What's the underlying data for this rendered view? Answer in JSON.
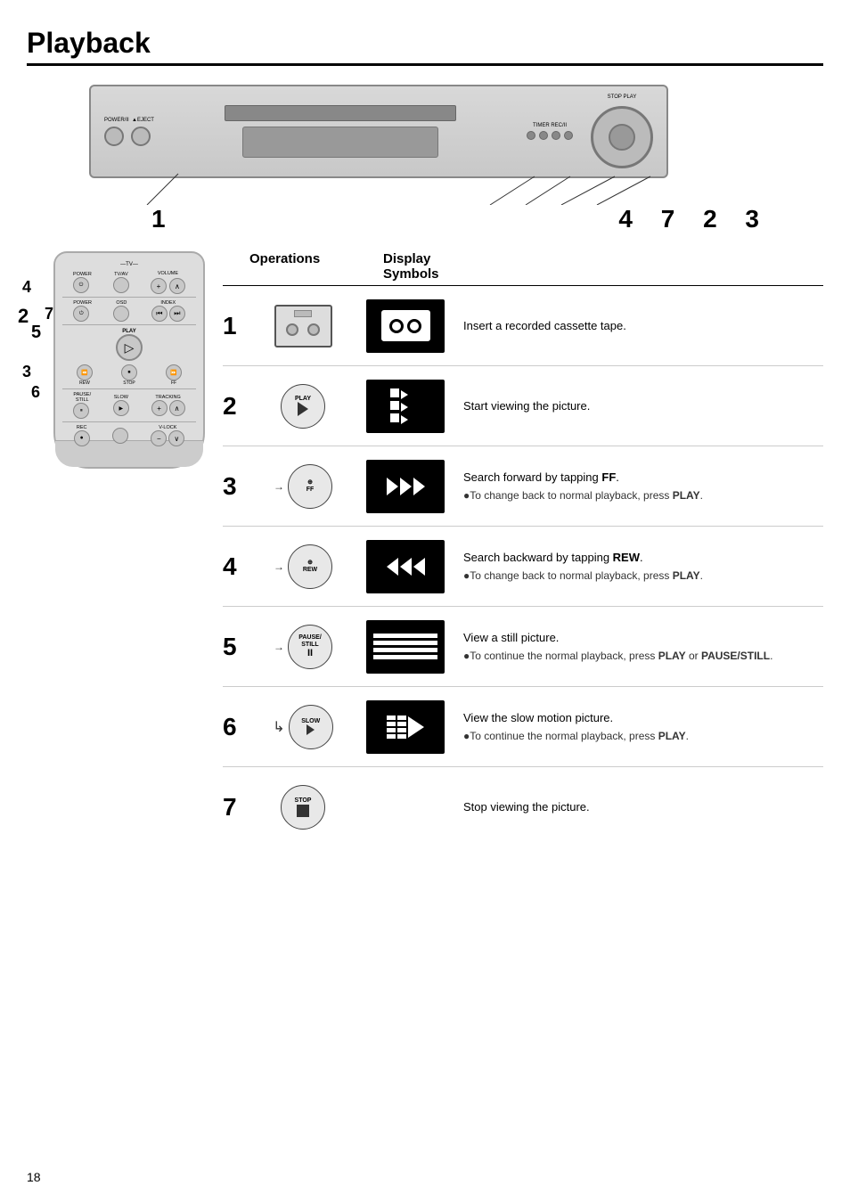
{
  "page": {
    "title": "Playback",
    "page_number": "18"
  },
  "diagram": {
    "numbers": {
      "num1": "1",
      "num_group": "4 7 2 3"
    }
  },
  "steps_header": {
    "operations": "Operations",
    "display_symbols": "Display Symbols"
  },
  "steps": [
    {
      "number": "1",
      "operation_label": "",
      "operation_detail": "Insert cassette",
      "description": "Insert a recorded cassette tape.",
      "description_bullets": []
    },
    {
      "number": "2",
      "operation_label": "PLAY",
      "operation_detail": "▷",
      "description": "Start viewing the picture.",
      "description_bullets": []
    },
    {
      "number": "3",
      "operation_label": "FF",
      "operation_detail": "⊕",
      "description": "Search forward by tapping FF.",
      "description_bullets": [
        "To change back to normal playback, press PLAY."
      ]
    },
    {
      "number": "4",
      "operation_label": "REW",
      "operation_detail": "⊕",
      "description": "Search backward by tapping REW.",
      "description_bullets": [
        "To change back to normal playback, press PLAY."
      ]
    },
    {
      "number": "5",
      "operation_label": "PAUSE/STILL",
      "operation_detail": "II",
      "description": "View a still picture.",
      "description_bullets": [
        "To continue the normal playback, press PLAY or PAUSE/STILL."
      ]
    },
    {
      "number": "6",
      "operation_label": "SLOW",
      "operation_detail": "▶",
      "description": "View the slow motion picture.",
      "description_bullets": [
        "To continue the normal playback, press PLAY."
      ]
    },
    {
      "number": "7",
      "operation_label": "STOP",
      "operation_detail": "□",
      "description": "Stop viewing the picture.",
      "description_bullets": []
    }
  ],
  "remote_labels": {
    "tv_label": "TV",
    "power_label": "POWER",
    "tvav_label": "TV/AV",
    "volume_label": "VOLUME",
    "osd_label": "OSD",
    "index_label": "INDEX",
    "play_label": "PLAY",
    "rew_label": "REW",
    "ff_label": "FF",
    "stop_label": "STOP",
    "pause_label": "PAUSE/",
    "still_label": "STILL",
    "slow_label": "SLOW",
    "tracking_label": "TRACKING",
    "rec_label": "REC",
    "vlock_label": "V-LOCK",
    "num2": "2",
    "num3": "3",
    "num4": "4",
    "num5": "5",
    "num6": "6",
    "num7": "7"
  }
}
